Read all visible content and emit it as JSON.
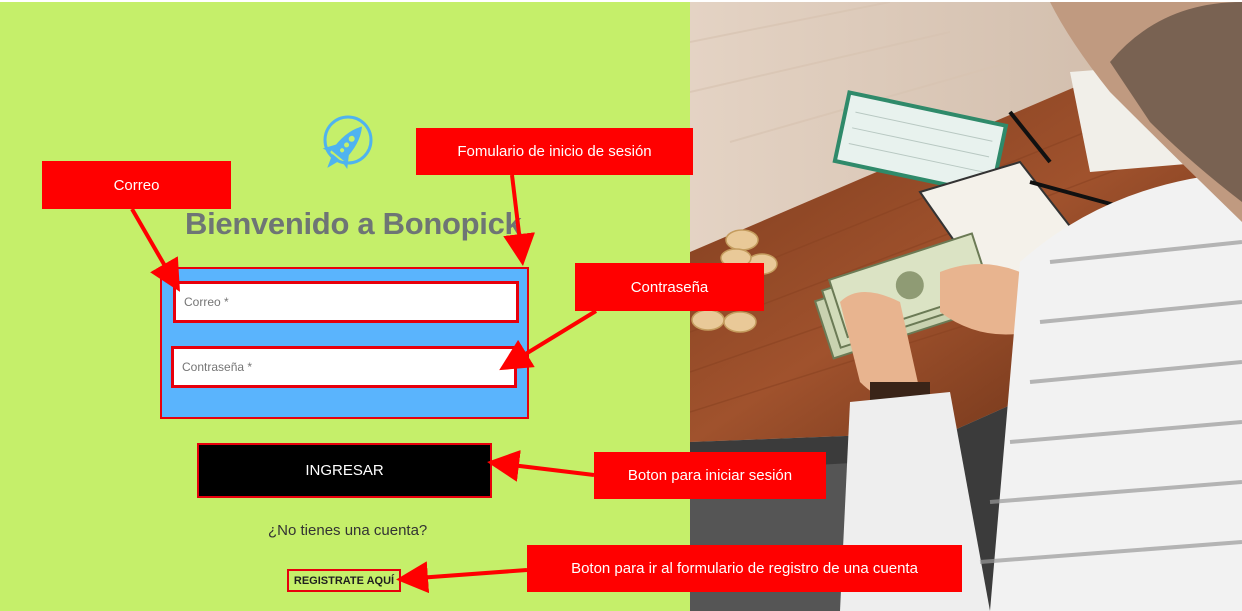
{
  "brand": {
    "title": "Bienvenido a Bonopick",
    "logo_icon": "rocket-icon"
  },
  "login_form": {
    "email_placeholder": "Correo *",
    "password_placeholder": "Contraseña *",
    "submit_label": "INGRESAR",
    "no_account_text": "¿No tienes una cuenta?",
    "register_label": "REGISTRATE AQUÍ"
  },
  "annotations": {
    "form": "Fomulario de inicio de sesión",
    "email": "Correo",
    "password": "Contraseña",
    "login_button": "Boton para iniciar sesión",
    "register_button": "Boton para ir al formulario de registro de una cuenta"
  },
  "colors": {
    "left_background": "#c5ef6a",
    "form_background": "#5ab4fd",
    "annotation_red": "#ff0000",
    "title_gray": "#6e7575"
  }
}
